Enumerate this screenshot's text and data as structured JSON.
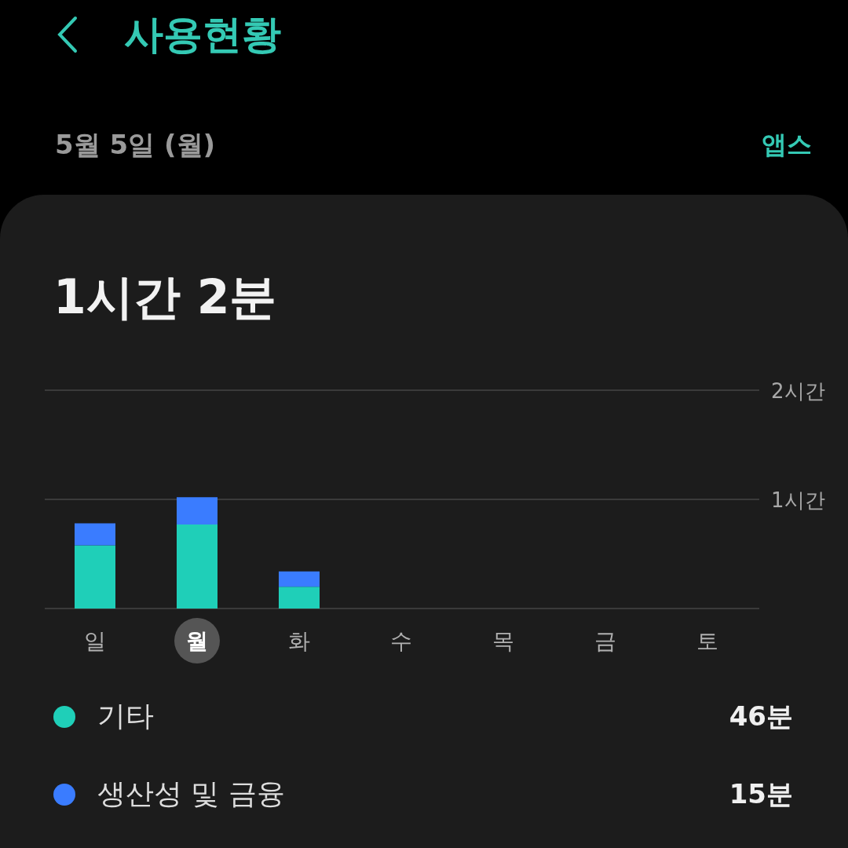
{
  "header": {
    "title": "사용현황",
    "date": "5월 5일 (월)",
    "apps_link": "앱스"
  },
  "summary": {
    "total": "1시간 2분"
  },
  "days": [
    {
      "selected": false
    },
    {
      "selected": true
    },
    {
      "selected": false
    },
    {
      "selected": false
    },
    {
      "selected": false
    },
    {
      "selected": false
    },
    {
      "selected": false
    }
  ],
  "chart_data": {
    "type": "bar",
    "stacked": true,
    "categories": [
      "일",
      "월",
      "화",
      "수",
      "목",
      "금",
      "토"
    ],
    "ylim": [
      0,
      2
    ],
    "yticks": [
      {
        "value": 1,
        "label": "1시간"
      },
      {
        "value": 2,
        "label": "2시간"
      }
    ],
    "series": [
      {
        "name": "기타",
        "color": "#1fcfb8",
        "values": [
          0.58,
          0.77,
          0.2,
          0,
          0,
          0,
          0
        ]
      },
      {
        "name": "생산성 및 금융",
        "color": "#3a7cff",
        "values": [
          0.2,
          0.25,
          0.14,
          0,
          0,
          0,
          0
        ]
      }
    ]
  },
  "legend": [
    {
      "value": "46분"
    },
    {
      "value": "15분"
    }
  ]
}
